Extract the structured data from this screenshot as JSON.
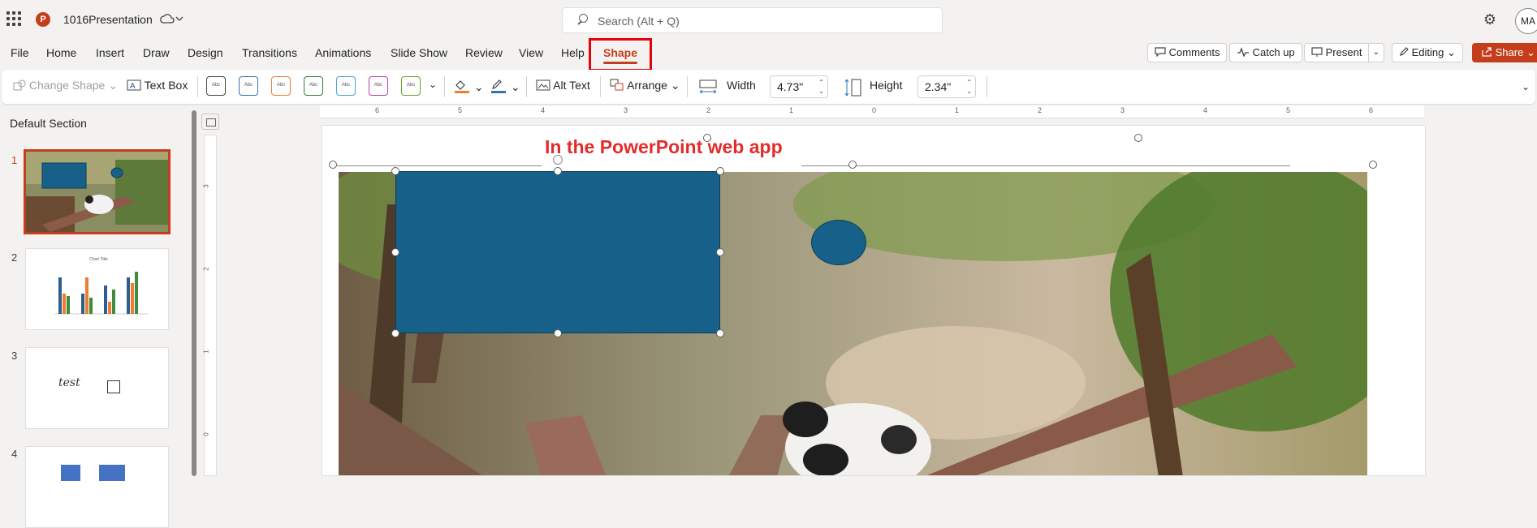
{
  "app": {
    "doc_title": "1016Presentation",
    "search_placeholder": "Search (Alt + Q)",
    "avatar_initials": "MA",
    "logo_letter": "P"
  },
  "menu": {
    "tabs": [
      "File",
      "Home",
      "Insert",
      "Draw",
      "Design",
      "Transitions",
      "Animations",
      "Slide Show",
      "Review",
      "View",
      "Help",
      "Shape"
    ],
    "active_tab": "Shape",
    "comments": "Comments",
    "catch_up": "Catch up",
    "present": "Present",
    "editing": "Editing",
    "share": "Share"
  },
  "ribbon": {
    "change_shape": "Change Shape",
    "text_box": "Text Box",
    "style_sample": "Abc",
    "alt_text": "Alt Text",
    "arrange": "Arrange",
    "width_label": "Width",
    "width_value": "4.73\"",
    "height_label": "Height",
    "height_value": "2.34\""
  },
  "colors": {
    "accent": "#c43e1c",
    "shape_fill": "#17608a",
    "highlight_box": "#e8000b",
    "title_red": "#e32b2b"
  },
  "sidebar": {
    "section_title": "Default Section",
    "slides": [
      {
        "number": "1"
      },
      {
        "number": "2",
        "chart_title": "Chart Title"
      },
      {
        "number": "3",
        "text": "test"
      },
      {
        "number": "4"
      }
    ]
  },
  "rulers": {
    "horizontal": [
      "6",
      "5",
      "4",
      "3",
      "2",
      "1",
      "0",
      "1",
      "2",
      "3",
      "4",
      "5",
      "6"
    ],
    "vertical": [
      "3",
      "2",
      "1",
      "0"
    ]
  },
  "slide": {
    "title": "In the PowerPoint web app"
  }
}
